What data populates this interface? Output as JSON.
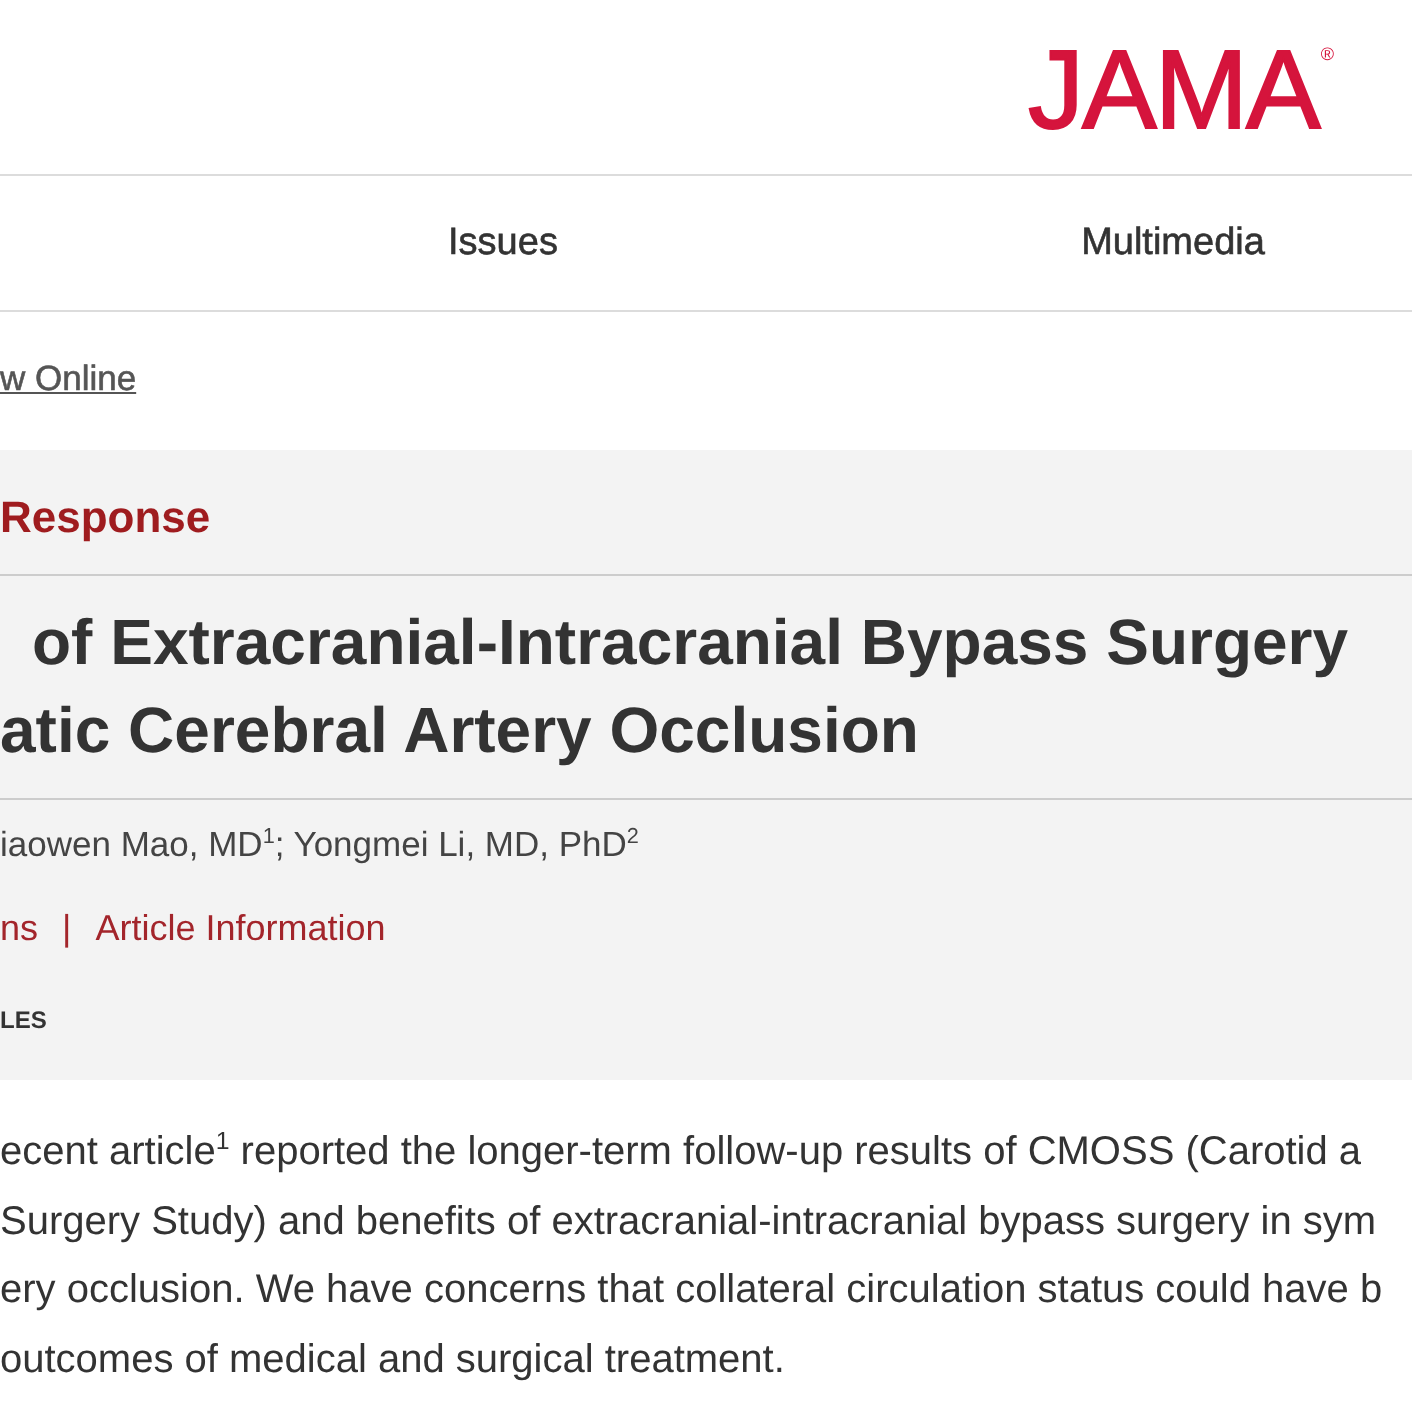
{
  "header": {
    "logo": {
      "text": "JAMA",
      "mark": "®"
    }
  },
  "nav": {
    "items": [
      {
        "label": "Issues"
      },
      {
        "label": "Multimedia"
      }
    ]
  },
  "view_link": "w Online",
  "article": {
    "type_label": "Response",
    "title_lines": [
      "of Extracranial-Intracranial Bypass Surgery",
      "atic Cerebral Artery Occlusion"
    ],
    "authors": "iaowen Mao, MD$^{1}$; Yongmei Li, MD, PhD$^{2}$",
    "info_links": {
      "items": [
        {
          "label": "ns"
        },
        {
          "label": "Article Information"
        }
      ],
      "separator": "|"
    },
    "section_label": "LES"
  },
  "body": {
    "lines": [
      "ecent article$^{1}$ reported the longer-term follow-up results of CMOSS (Carotid a",
      "Surgery Study) and benefits of extracranial-intracranial bypass surgery in sym",
      "ery occlusion. We have concerns that collateral circulation status could have b",
      "outcomes of medical and surgical treatment."
    ]
  }
}
